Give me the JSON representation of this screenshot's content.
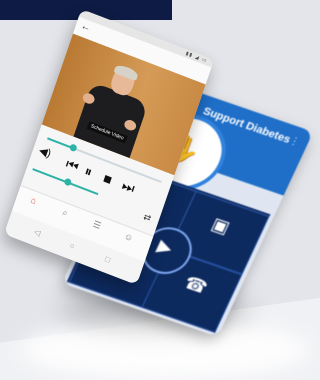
{
  "scene": {
    "banner_color": "#0e1b44",
    "background_color": "#f0f1f4"
  },
  "back_phone": {
    "title": "Support Diabetes",
    "menu_icon": "more-vertical-icon",
    "header_icon": "hands-icon",
    "tiles": [
      {
        "icon": "book-icon",
        "label": ""
      },
      {
        "icon": "video-icon",
        "label": ""
      },
      {
        "icon": "people-icon",
        "label": ""
      },
      {
        "icon": "phone-icon",
        "label": ""
      }
    ],
    "center_icon": "play-icon",
    "accent": "#1f6fc9"
  },
  "front_phone": {
    "app_title": "",
    "video": {
      "caption": "Schedule Video",
      "background_color": "#c98a44"
    },
    "player": {
      "progress": 0.22,
      "speed_level": 0.5,
      "accent": "#2bb3a6"
    },
    "tabs": [
      {
        "icon": "home-icon",
        "label": ""
      },
      {
        "icon": "search-icon",
        "label": ""
      },
      {
        "icon": "list-icon",
        "label": ""
      },
      {
        "icon": "person-icon",
        "label": ""
      }
    ]
  }
}
